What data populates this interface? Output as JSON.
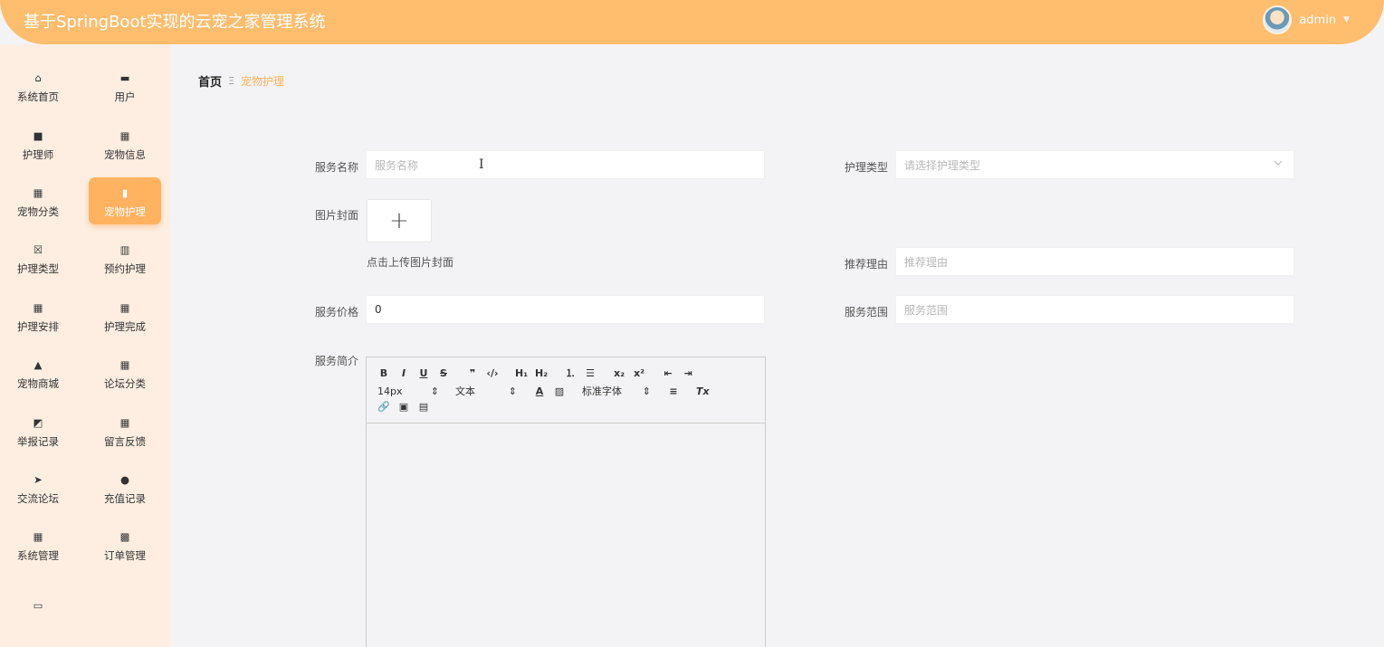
{
  "header": {
    "title": "基于SpringBoot实现的云宠之家管理系统",
    "username": "admin",
    "caret": "▼"
  },
  "sidebar": {
    "items": [
      {
        "label": "系统首页",
        "icon": "home-icon",
        "glyph": "⌂"
      },
      {
        "label": "用户",
        "icon": "monitor-icon",
        "glyph": "▬"
      },
      {
        "label": "护理师",
        "icon": "briefcase-icon",
        "glyph": "■"
      },
      {
        "label": "宠物信息",
        "icon": "grid-icon",
        "glyph": "▦"
      },
      {
        "label": "宠物分类",
        "icon": "grid-icon",
        "glyph": "▦"
      },
      {
        "label": "宠物护理",
        "icon": "book-icon",
        "glyph": "▮"
      },
      {
        "label": "护理类型",
        "icon": "clipboard-x-icon",
        "glyph": "☒"
      },
      {
        "label": "预约护理",
        "icon": "bar-chart-icon",
        "glyph": "▥"
      },
      {
        "label": "护理安排",
        "icon": "grid-icon",
        "glyph": "▦"
      },
      {
        "label": "护理完成",
        "icon": "grid-icon",
        "glyph": "▦"
      },
      {
        "label": "宠物商城",
        "icon": "user-stamp-icon",
        "glyph": "▲"
      },
      {
        "label": "论坛分类",
        "icon": "grid-icon",
        "glyph": "▦"
      },
      {
        "label": "举报记录",
        "icon": "line-chart-icon",
        "glyph": "◩"
      },
      {
        "label": "留言反馈",
        "icon": "grid-icon",
        "glyph": "▦"
      },
      {
        "label": "交流论坛",
        "icon": "paper-plane-icon",
        "glyph": "➤"
      },
      {
        "label": "充值记录",
        "icon": "user-icon",
        "glyph": "●"
      },
      {
        "label": "系统管理",
        "icon": "grid-icon",
        "glyph": "▦"
      },
      {
        "label": "订单管理",
        "icon": "grid-9-icon",
        "glyph": "▩"
      },
      {
        "label": "",
        "icon": "wallet-icon",
        "glyph": "▭"
      }
    ],
    "active_index": 5
  },
  "breadcrumb": {
    "home": "首页",
    "separator": "Ξ",
    "current": "宠物护理"
  },
  "form": {
    "service_name": {
      "label": "服务名称",
      "placeholder": "服务名称",
      "value": ""
    },
    "care_type": {
      "label": "护理类型",
      "placeholder": "请选择护理类型",
      "value": ""
    },
    "cover_image": {
      "label": "图片封面",
      "upload_symbol": "+",
      "hint": "点击上传图片封面"
    },
    "recommend_reason": {
      "label": "推荐理由",
      "placeholder": "推荐理由",
      "value": ""
    },
    "service_price": {
      "label": "服务价格",
      "value": "0"
    },
    "service_scope": {
      "label": "服务范围",
      "placeholder": "服务范围",
      "value": ""
    },
    "service_intro": {
      "label": "服务简介"
    }
  },
  "editor": {
    "row1": [
      "B",
      "I",
      "U",
      "S",
      "❞",
      "‹/›",
      "H₁",
      "H₂",
      "⒈",
      "☰",
      "x₂",
      "x²",
      "⇤",
      "⇥"
    ],
    "font_size": "14px",
    "block_type": "文本",
    "font_family": "标准字体",
    "color_glyph": "A",
    "bg_glyph": "▨",
    "align_glyph": "≡",
    "clear_glyph": "Tx",
    "row3": [
      "🔗",
      "▣",
      "▤"
    ],
    "select_caret": "⇕"
  },
  "colors": {
    "accent": "#ffb25f",
    "header": "#ffbd6e",
    "sidebar_bg": "#fdeee1"
  }
}
